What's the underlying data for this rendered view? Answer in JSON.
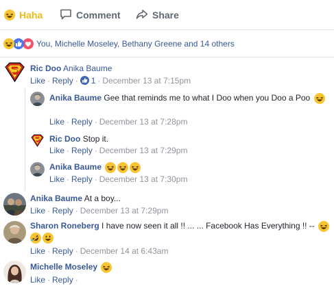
{
  "actions": {
    "haha_label": "Haha",
    "comment_label": "Comment",
    "share_label": "Share"
  },
  "reactions": {
    "summary": "You, Michelle Moseley, Bethany Greene and 14 others"
  },
  "comments": [
    {
      "author": "Ric Doo",
      "text": "Anika Baume",
      "like": "Like",
      "reply": "Reply",
      "reaction_count": "1",
      "time": "December 13 at 7:15pm"
    },
    {
      "author": "Anika Baume",
      "text": "Gee that reminds me to what I Doo when you Doo a Poo",
      "like": "Like",
      "reply": "Reply",
      "time": "December 13 at 7:28pm"
    },
    {
      "author": "Ric Doo",
      "text": "Stop it.",
      "like": "Like",
      "reply": "Reply",
      "time": "December 13 at 7:29pm"
    },
    {
      "author": "Anika Baume",
      "text": "",
      "like": "Like",
      "reply": "Reply",
      "time": "December 13 at 7:30pm"
    },
    {
      "author": "Anika Baume",
      "text": "At a boy...",
      "like": "Like",
      "reply": "Reply",
      "time": "December 13 at 7:29pm"
    },
    {
      "author": "Sharon Roneberg",
      "text": "I have now seen it all !! ... ... Facebook Has Everything !! --",
      "like": "Like",
      "reply": "Reply",
      "time": "December 14 at 6:43am"
    },
    {
      "author": "Michelle Moseley",
      "text": "",
      "like": "Like",
      "reply": "Reply"
    }
  ],
  "colors": {
    "link": "#385898",
    "meta": "#90949c",
    "haha": "#f0ba15",
    "like_blue": "#4267b2",
    "love_red": "#f25268"
  }
}
